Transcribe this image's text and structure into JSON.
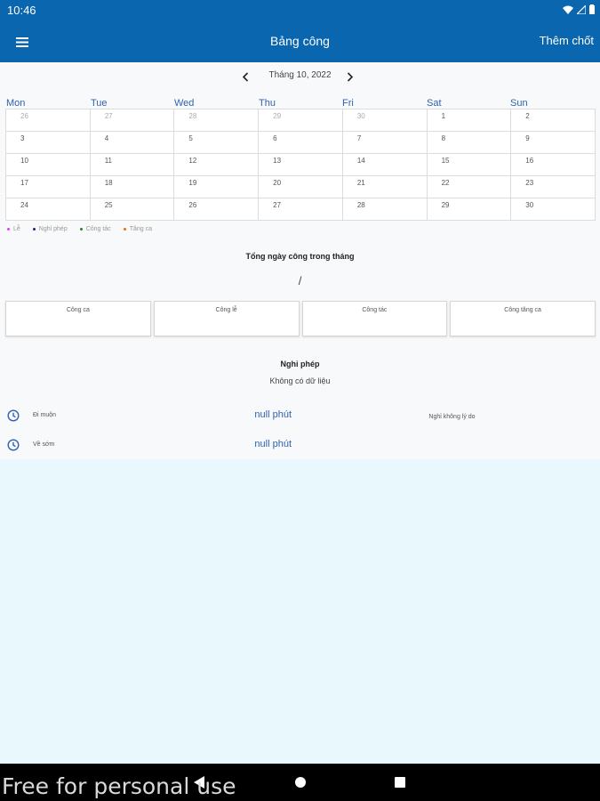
{
  "status_bar": {
    "time": "10:46"
  },
  "app_bar": {
    "title": "Bảng công",
    "action": "Thêm chốt"
  },
  "calendar": {
    "month_label": "Tháng 10, 2022",
    "weekdays": [
      "Mon",
      "Tue",
      "Wed",
      "Thu",
      "Fri",
      "Sat",
      "Sun"
    ],
    "weeks": [
      [
        "26",
        "27",
        "28",
        "29",
        "30",
        "1",
        "2"
      ],
      [
        "3",
        "4",
        "5",
        "6",
        "7",
        "8",
        "9"
      ],
      [
        "10",
        "11",
        "12",
        "13",
        "14",
        "15",
        "16"
      ],
      [
        "17",
        "18",
        "19",
        "20",
        "21",
        "22",
        "23"
      ],
      [
        "24",
        "25",
        "26",
        "27",
        "28",
        "29",
        "30"
      ]
    ]
  },
  "legend": [
    {
      "label": "Lễ",
      "color": "#e040fb"
    },
    {
      "label": "Nghỉ phép",
      "color": "#1a237e"
    },
    {
      "label": "Công tác",
      "color": "#2e7d32"
    },
    {
      "label": "Tăng ca",
      "color": "#ef6c00"
    }
  ],
  "summary": {
    "title": "Tổng ngày công trong tháng",
    "value": "/",
    "boxes": [
      "Công ca",
      "Công lễ",
      "Công tác",
      "Công tăng ca"
    ]
  },
  "leave": {
    "title": "Nghỉ phép",
    "empty_text": "Không có dữ liệu"
  },
  "lateness": [
    {
      "label": "Đi muộn",
      "value": "null phút"
    },
    {
      "label": "Về sớm",
      "value": "null phút"
    }
  ],
  "unexcused_label": "Nghỉ không lý do",
  "watermark": "Free for personal use",
  "colors": {
    "primary": "#0a66ae",
    "background": "#e8f8fd",
    "accent_text": "#2f62b0"
  }
}
